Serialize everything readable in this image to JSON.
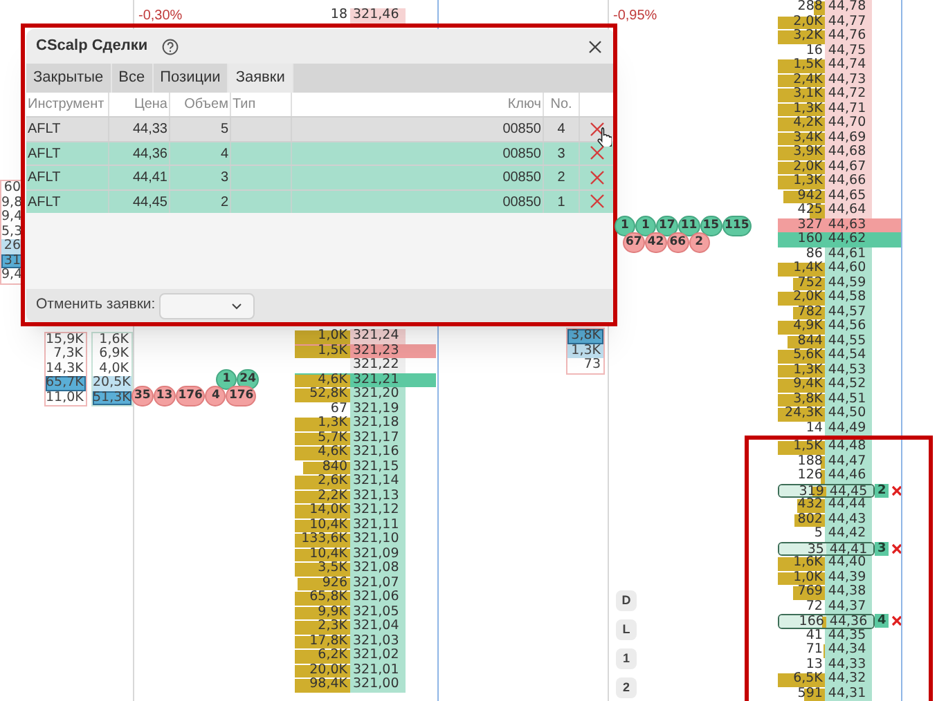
{
  "left_panel": {
    "edge_column": [
      {
        "value": "60",
        "kind": "plain"
      },
      {
        "value": "9,8",
        "kind": "plain"
      },
      {
        "value": "9,4",
        "kind": "plain"
      },
      {
        "value": "5,3",
        "kind": "plain"
      },
      {
        "value": "26",
        "kind": "light"
      },
      {
        "value": "31",
        "kind": "strong"
      },
      {
        "value": "9,4",
        "kind": "plain"
      }
    ],
    "column_a": [
      {
        "value": "15,9K",
        "kind": "plain"
      },
      {
        "value": "7,3K",
        "kind": "plain"
      },
      {
        "value": "14,3K",
        "kind": "plain"
      },
      {
        "value": "65,7K",
        "kind": "strong"
      },
      {
        "value": "11,0K",
        "kind": "plain"
      }
    ],
    "column_b": [
      {
        "value": "1,6K",
        "kind": "plain"
      },
      {
        "value": "6,9K",
        "kind": "plain"
      },
      {
        "value": "4,0K",
        "kind": "plain"
      },
      {
        "value": "20,5K",
        "kind": "light"
      },
      {
        "value": "51,3K",
        "kind": "strong"
      }
    ]
  },
  "middle_panel": {
    "change": "-0,30%",
    "trade_bubbles": [
      {
        "text": "1",
        "kind": "buy"
      },
      {
        "text": "24",
        "kind": "buy"
      },
      {
        "text": "35",
        "kind": "sell"
      },
      {
        "text": "13",
        "kind": "sell"
      },
      {
        "text": "176",
        "kind": "sell"
      },
      {
        "text": "4",
        "kind": "sell"
      },
      {
        "text": "176",
        "kind": "sell"
      }
    ],
    "ladder": {
      "upper_rows": [
        {
          "volume": "18",
          "price": "321,46",
          "kind": "ask",
          "level": 0
        }
      ],
      "lower_rows": [
        {
          "volume": "1,0K",
          "price": "321,24",
          "kind": "ask",
          "level": 1
        },
        {
          "volume": "1,5K",
          "price": "321,23",
          "kind": "best_ask",
          "level": 1
        },
        {
          "price": "321,22",
          "kind": "spread"
        },
        {
          "volume": "4,6K",
          "price": "321,21",
          "kind": "best_bid",
          "level": 1
        },
        {
          "volume": "52,8K",
          "price": "321,20",
          "kind": "bid",
          "level": 1
        },
        {
          "volume": "67",
          "price": "321,19",
          "kind": "bid",
          "level": 0
        },
        {
          "volume": "1,3K",
          "price": "321,18",
          "kind": "bid",
          "level": 1
        },
        {
          "volume": "5,7K",
          "price": "321,17",
          "kind": "bid",
          "level": 1
        },
        {
          "volume": "4,6K",
          "price": "321,16",
          "kind": "bid",
          "level": 1
        },
        {
          "volume": "840",
          "price": "321,15",
          "kind": "bid",
          "level": 0.85
        },
        {
          "volume": "2,6K",
          "price": "321,14",
          "kind": "bid",
          "level": 1
        },
        {
          "volume": "2,2K",
          "price": "321,13",
          "kind": "bid",
          "level": 1
        },
        {
          "volume": "14,0K",
          "price": "321,12",
          "kind": "bid",
          "level": 1
        },
        {
          "volume": "10,4K",
          "price": "321,11",
          "kind": "bid",
          "level": 1
        },
        {
          "volume": "133,6K",
          "price": "321,10",
          "kind": "bid",
          "level": 1
        },
        {
          "volume": "10,4K",
          "price": "321,09",
          "kind": "bid",
          "level": 1
        },
        {
          "volume": "3,5K",
          "price": "321,08",
          "kind": "bid",
          "level": 1
        },
        {
          "volume": "926",
          "price": "321,07",
          "kind": "bid",
          "level": 0.95
        },
        {
          "volume": "65,8K",
          "price": "321,06",
          "kind": "bid",
          "level": 1
        },
        {
          "volume": "9,9K",
          "price": "321,05",
          "kind": "bid",
          "level": 1
        },
        {
          "volume": "2,3K",
          "price": "321,04",
          "kind": "bid",
          "level": 1
        },
        {
          "volume": "17,8K",
          "price": "321,03",
          "kind": "bid",
          "level": 1
        },
        {
          "volume": "6,2K",
          "price": "321,02",
          "kind": "bid",
          "level": 1
        },
        {
          "volume": "20,0K",
          "price": "321,01",
          "kind": "bid",
          "level": 1
        },
        {
          "volume": "98,4K",
          "price": "321,00",
          "kind": "bid",
          "level": 1
        }
      ]
    }
  },
  "third_panel": {
    "volume_column": [
      {
        "value": "3,8K",
        "kind": "strong"
      },
      {
        "value": "1,3K",
        "kind": "light"
      },
      {
        "value": "73",
        "kind": "plain"
      }
    ]
  },
  "right_panel": {
    "change": "-0,95%",
    "trade_bubbles": [
      {
        "text": "1",
        "kind": "buy"
      },
      {
        "text": "1",
        "kind": "buy"
      },
      {
        "text": "17",
        "kind": "buy"
      },
      {
        "text": "11",
        "kind": "buy"
      },
      {
        "text": "15",
        "kind": "buy"
      },
      {
        "text": "115",
        "kind": "buy"
      },
      {
        "text": "67",
        "kind": "sell"
      },
      {
        "text": "42",
        "kind": "sell"
      },
      {
        "text": "66",
        "kind": "sell"
      },
      {
        "text": "2",
        "kind": "sell"
      }
    ],
    "side_buttons": [
      "D",
      "L",
      "1",
      "2"
    ],
    "ladder": {
      "rows": [
        {
          "volume": "288",
          "price": "44,78",
          "kind": "ask",
          "level": 0.25
        },
        {
          "volume": "2,0K",
          "price": "44,77",
          "kind": "ask",
          "level": 1
        },
        {
          "volume": "3,2K",
          "price": "44,76",
          "kind": "ask",
          "level": 1
        },
        {
          "volume": "16",
          "price": "44,75",
          "kind": "ask",
          "level": 0
        },
        {
          "volume": "1,5K",
          "price": "44,74",
          "kind": "ask",
          "level": 1
        },
        {
          "volume": "2,4K",
          "price": "44,73",
          "kind": "ask",
          "level": 1
        },
        {
          "volume": "3,1K",
          "price": "44,72",
          "kind": "ask",
          "level": 1
        },
        {
          "volume": "1,3K",
          "price": "44,71",
          "kind": "ask",
          "level": 1
        },
        {
          "volume": "4,2K",
          "price": "44,70",
          "kind": "ask",
          "level": 1
        },
        {
          "volume": "3,4K",
          "price": "44,69",
          "kind": "ask",
          "level": 1
        },
        {
          "volume": "3,9K",
          "price": "44,68",
          "kind": "ask",
          "level": 1
        },
        {
          "volume": "2,0K",
          "price": "44,67",
          "kind": "ask",
          "level": 1
        },
        {
          "volume": "1,3K",
          "price": "44,66",
          "kind": "ask",
          "level": 1
        },
        {
          "volume": "942",
          "price": "44,65",
          "kind": "ask",
          "level": 0.9
        },
        {
          "volume": "425",
          "price": "44,64",
          "kind": "ask",
          "level": 0.35
        },
        {
          "volume": "327",
          "price": "44,63",
          "kind": "best_ask",
          "level": 0
        },
        {
          "volume": "160",
          "price": "44,62",
          "kind": "best_bid",
          "level": 0
        },
        {
          "volume": "86",
          "price": "44,61",
          "kind": "bid",
          "level": 0
        },
        {
          "volume": "1,4K",
          "price": "44,60",
          "kind": "bid",
          "level": 1
        },
        {
          "volume": "752",
          "price": "44,59",
          "kind": "bid",
          "level": 0.7
        },
        {
          "volume": "2,0K",
          "price": "44,58",
          "kind": "bid",
          "level": 1
        },
        {
          "volume": "782",
          "price": "44,57",
          "kind": "bid",
          "level": 0.7
        },
        {
          "volume": "4,9K",
          "price": "44,56",
          "kind": "bid",
          "level": 1
        },
        {
          "volume": "844",
          "price": "44,55",
          "kind": "bid",
          "level": 0.8
        },
        {
          "volume": "5,6K",
          "price": "44,54",
          "kind": "bid",
          "level": 1
        },
        {
          "volume": "1,3K",
          "price": "44,53",
          "kind": "bid",
          "level": 1
        },
        {
          "volume": "9,4K",
          "price": "44,52",
          "kind": "bid",
          "level": 1
        },
        {
          "volume": "3,8K",
          "price": "44,51",
          "kind": "bid",
          "level": 1
        },
        {
          "volume": "24,3K",
          "price": "44,50",
          "kind": "bid",
          "level": 1
        },
        {
          "volume": "14",
          "price": "44,49",
          "kind": "bid",
          "level": 0
        },
        {
          "volume": "1,5K",
          "price": "44,48",
          "kind": "bid",
          "level": 1
        },
        {
          "volume": "188",
          "price": "44,47",
          "kind": "bid",
          "level": 0.1
        },
        {
          "volume": "126",
          "price": "44,46",
          "kind": "bid",
          "level": 0.1
        },
        {
          "volume": "319",
          "price": "44,45",
          "kind": "bid",
          "level": 0.3,
          "order": "2"
        },
        {
          "volume": "432",
          "price": "44,44",
          "kind": "bid",
          "level": 0.6
        },
        {
          "volume": "802",
          "price": "44,43",
          "kind": "bid",
          "level": 0.65
        },
        {
          "volume": "5",
          "price": "44,42",
          "kind": "bid",
          "level": 0
        },
        {
          "volume": "35",
          "price": "44,41",
          "kind": "bid",
          "level": 0,
          "order": "3"
        },
        {
          "volume": "1,6K",
          "price": "44,40",
          "kind": "bid",
          "level": 1
        },
        {
          "volume": "1,0K",
          "price": "44,39",
          "kind": "bid",
          "level": 1
        },
        {
          "volume": "769",
          "price": "44,38",
          "kind": "bid",
          "level": 0.7
        },
        {
          "volume": "72",
          "price": "44,37",
          "kind": "bid",
          "level": 0
        },
        {
          "volume": "166",
          "price": "44,36",
          "kind": "bid",
          "level": 0.1,
          "order": "4"
        },
        {
          "volume": "41",
          "price": "44,35",
          "kind": "bid",
          "level": 0
        },
        {
          "volume": "71",
          "price": "44,34",
          "kind": "bid",
          "level": 0.05
        },
        {
          "volume": "13",
          "price": "44,33",
          "kind": "bid",
          "level": 0
        },
        {
          "volume": "6,5K",
          "price": "44,32",
          "kind": "bid",
          "level": 1
        },
        {
          "volume": "591",
          "price": "44,31",
          "kind": "bid",
          "level": 0.45
        }
      ]
    }
  },
  "deals_window": {
    "title": "CScalp Сделки",
    "tabs": [
      {
        "label": "Закрытые",
        "selected": false
      },
      {
        "label": "Все",
        "selected": false
      },
      {
        "label": "Позиции",
        "selected": false
      },
      {
        "label": "Заявки",
        "selected": true
      }
    ],
    "columns": [
      "Инструмент",
      "Цена",
      "Объем",
      "Тип",
      "Ключ",
      "No."
    ],
    "rows": [
      {
        "instrument": "AFLT",
        "price": "44,33",
        "volume": "5",
        "key": "00850",
        "no": "4",
        "hovered": true
      },
      {
        "instrument": "AFLT",
        "price": "44,36",
        "volume": "4",
        "key": "00850",
        "no": "3",
        "hovered": false
      },
      {
        "instrument": "AFLT",
        "price": "44,41",
        "volume": "3",
        "key": "00850",
        "no": "2",
        "hovered": false
      },
      {
        "instrument": "AFLT",
        "price": "44,45",
        "volume": "2",
        "key": "00850",
        "no": "1",
        "hovered": false
      }
    ],
    "cancel_label": "Отменить заявки:"
  }
}
